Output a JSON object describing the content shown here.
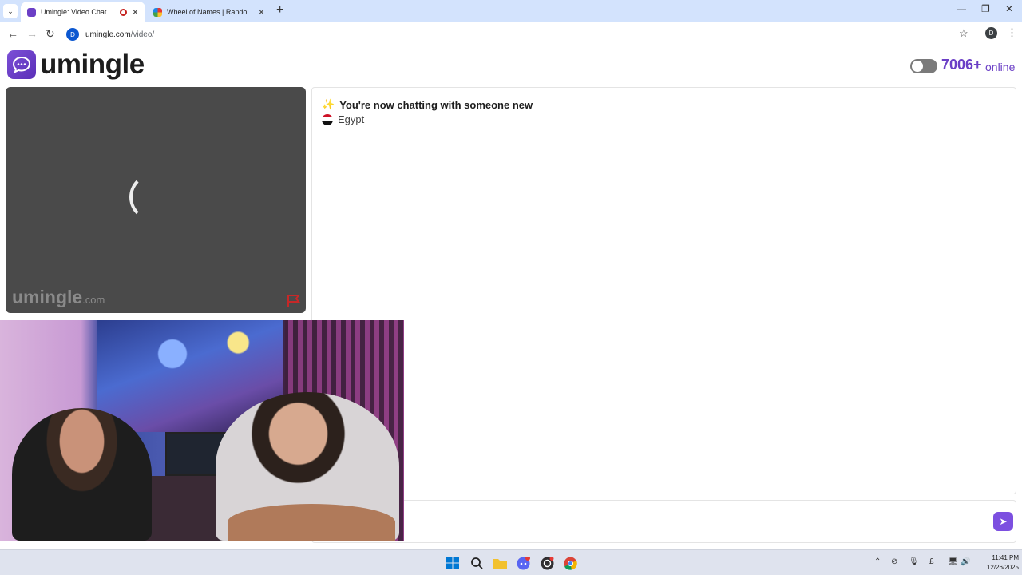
{
  "browser": {
    "tabs": [
      {
        "title": "Umingle: Video Chat with Strangers",
        "active": true
      },
      {
        "title": "Wheel of Names | Random name picker",
        "active": false
      }
    ],
    "url_host": "umingle.com",
    "url_path": "/video/",
    "profile_initial": "D",
    "site_icon_letter": "D"
  },
  "header": {
    "logo_text": "umingle",
    "online_count": "7006+",
    "online_label": "online",
    "dark_mode_toggle_on": false
  },
  "remote_video": {
    "watermark": "umingle",
    "watermark_domain": ".com"
  },
  "chat": {
    "system_message": "You're now chatting with someone new",
    "country": "Egypt",
    "accent_color": "#7c4fe0"
  },
  "taskbar": {
    "time": "11:41 PM",
    "date": "12/26/2025",
    "badge_count": "99+"
  }
}
